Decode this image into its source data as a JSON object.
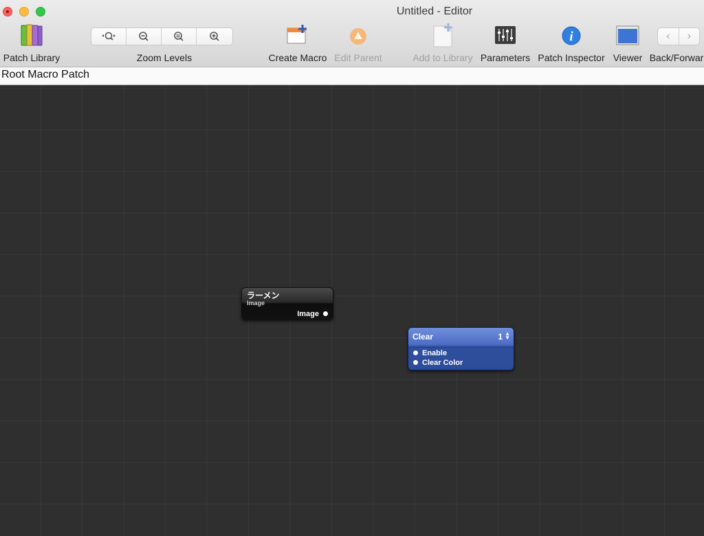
{
  "window": {
    "title": "Untitled - Editor"
  },
  "toolbar": {
    "patch_library": "Patch Library",
    "zoom_levels": "Zoom Levels",
    "create_macro": "Create Macro",
    "edit_parent": "Edit Parent",
    "add_to_library": "Add to Library",
    "parameters": "Parameters",
    "patch_inspector": "Patch Inspector",
    "viewer": "Viewer",
    "back_forward": "Back/Forwar"
  },
  "path": {
    "label": "Root Macro Patch"
  },
  "patches": {
    "image_patch": {
      "title": "ラーメン",
      "subtitle": "Image",
      "output": "Image"
    },
    "clear_patch": {
      "title": "Clear",
      "count": "1",
      "inputs": [
        "Enable",
        "Clear Color"
      ]
    }
  },
  "colors": {
    "canvas": "#2f2f2f",
    "clear_patch_blue": "#2d4c99",
    "image_patch_black": "#111111"
  }
}
